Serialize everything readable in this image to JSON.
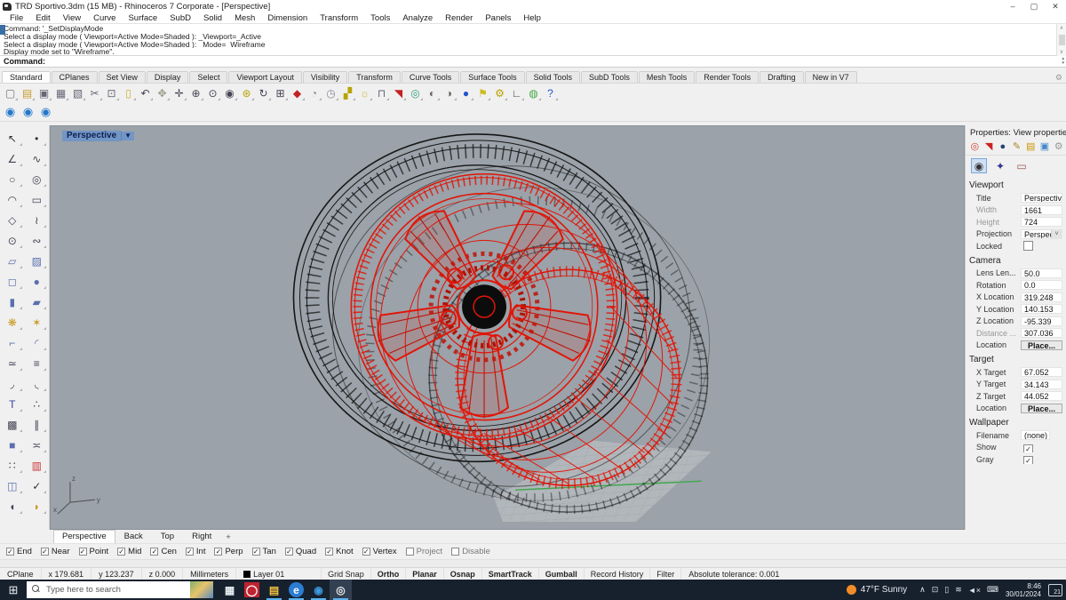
{
  "window": {
    "title": "TRD Sportivo.3dm (15 MB) - Rhinoceros 7 Corporate - [Perspective]",
    "controls": {
      "minimize": "–",
      "maximize": "▢",
      "close": "✕"
    }
  },
  "menu": {
    "items": [
      "File",
      "Edit",
      "View",
      "Curve",
      "Surface",
      "SubD",
      "Solid",
      "Mesh",
      "Dimension",
      "Transform",
      "Tools",
      "Analyze",
      "Render",
      "Panels",
      "Help"
    ]
  },
  "command": {
    "history": [
      "Command: '_SetDisplayMode",
      "Select a display mode ( Viewport=Active  Mode=Shaded ): _Viewport=_Active",
      "Select a display mode ( Viewport=Active  Mode=Shaded ): _Mode=_Wireframe",
      "Display mode set to \"Wireframe\"."
    ],
    "prompt": "Command:"
  },
  "tabbar": {
    "items": [
      {
        "label": "Standard",
        "active": true
      },
      {
        "label": "CPlanes"
      },
      {
        "label": "Set View"
      },
      {
        "label": "Display"
      },
      {
        "label": "Select"
      },
      {
        "label": "Viewport Layout"
      },
      {
        "label": "Visibility"
      },
      {
        "label": "Transform"
      },
      {
        "label": "Curve Tools"
      },
      {
        "label": "Surface Tools"
      },
      {
        "label": "Solid Tools"
      },
      {
        "label": "SubD Tools"
      },
      {
        "label": "Mesh Tools"
      },
      {
        "label": "Render Tools"
      },
      {
        "label": "Drafting"
      },
      {
        "label": "New in V7"
      }
    ],
    "gear": "⚙"
  },
  "toolbar1": {
    "icons": [
      {
        "name": "new-file-icon",
        "glyph": "▢",
        "color": "#777"
      },
      {
        "name": "open-file-icon",
        "glyph": "▤",
        "color": "#c99a2e"
      },
      {
        "name": "save-icon",
        "glyph": "▣",
        "color": "#667"
      },
      {
        "name": "print-icon",
        "glyph": "▦",
        "color": "#667"
      },
      {
        "name": "export-icon",
        "glyph": "▧",
        "color": "#667"
      },
      {
        "name": "cut-icon",
        "glyph": "✂",
        "color": "#667"
      },
      {
        "name": "copy-icon",
        "glyph": "⊡",
        "color": "#667"
      },
      {
        "name": "paste-icon",
        "glyph": "▯",
        "color": "#c9b22e"
      },
      {
        "name": "undo-icon",
        "glyph": "↶",
        "color": "#445"
      },
      {
        "name": "pan-icon",
        "glyph": "✥",
        "color": "#998"
      },
      {
        "name": "move-icon",
        "glyph": "✛",
        "color": "#445"
      },
      {
        "name": "zoom-dynamic-icon",
        "glyph": "⊕",
        "color": "#445"
      },
      {
        "name": "zoom-window-icon",
        "glyph": "⊙",
        "color": "#445"
      },
      {
        "name": "zoom-selected-icon",
        "glyph": "◉",
        "color": "#445"
      },
      {
        "name": "zoom-extents-icon",
        "glyph": "⊛",
        "color": "#b8a300"
      },
      {
        "name": "rotate-view-icon",
        "glyph": "↻",
        "color": "#445"
      },
      {
        "name": "viewport-layout-icon",
        "glyph": "⊞",
        "color": "#445"
      },
      {
        "name": "shaded-viewport-icon",
        "glyph": "◆",
        "color": "#c22222"
      },
      {
        "name": "set-view-icon",
        "glyph": "◔",
        "color": "#889"
      },
      {
        "name": "named-view-icon",
        "glyph": "◷",
        "color": "#889"
      },
      {
        "name": "cplane-icon",
        "glyph": "▞",
        "color": "#b8a300"
      },
      {
        "name": "lightbulb-icon",
        "glyph": "☼",
        "color": "#c9b22e"
      },
      {
        "name": "lock-icon",
        "glyph": "⊓",
        "color": "#667"
      },
      {
        "name": "display-mode-icon",
        "glyph": "◥",
        "color": "#c22222"
      },
      {
        "name": "color-wheel-icon",
        "glyph": "◎",
        "color": "#33a07a"
      },
      {
        "name": "shaded-sphere-icon",
        "glyph": "◐",
        "color": "#666"
      },
      {
        "name": "rendered-sphere-icon",
        "glyph": "◑",
        "color": "#666"
      },
      {
        "name": "raytraced-sphere-icon",
        "glyph": "●",
        "color": "#2255cc"
      },
      {
        "name": "flag-icon",
        "glyph": "⚑",
        "color": "#ccbb22"
      },
      {
        "name": "options-gear-icon",
        "glyph": "⚙",
        "color": "#b8a300"
      },
      {
        "name": "dimension-icon",
        "glyph": "∟",
        "color": "#445"
      },
      {
        "name": "earth-icon",
        "glyph": "◍",
        "color": "#44aa44"
      },
      {
        "name": "help-icon",
        "glyph": "?",
        "color": "#2255cc"
      }
    ]
  },
  "toolbar2": {
    "icons": [
      {
        "name": "blue-dial-icon-1",
        "glyph": "◉",
        "color": "#2277cc"
      },
      {
        "name": "blue-dial-icon-2",
        "glyph": "◉",
        "color": "#2277cc"
      },
      {
        "name": "blue-dial-icon-3",
        "glyph": "◉",
        "color": "#2277cc"
      }
    ]
  },
  "left_toolbar": {
    "icons": [
      {
        "name": "select-arrow-icon",
        "glyph": "↖",
        "color": "#333"
      },
      {
        "name": "point-icon",
        "glyph": "•",
        "color": "#333"
      },
      {
        "name": "polyline-icon",
        "glyph": "∠",
        "color": "#445"
      },
      {
        "name": "control-point-curve-icon",
        "glyph": "∿",
        "color": "#445"
      },
      {
        "name": "circle-icon",
        "glyph": "○",
        "color": "#445"
      },
      {
        "name": "ellipse-icon",
        "glyph": "◎",
        "color": "#445"
      },
      {
        "name": "arc-icon",
        "glyph": "◠",
        "color": "#445"
      },
      {
        "name": "rectangle-icon",
        "glyph": "▭",
        "color": "#445"
      },
      {
        "name": "polygon-icon",
        "glyph": "◇",
        "color": "#445"
      },
      {
        "name": "freeform-curve-icon",
        "glyph": "≀",
        "color": "#445"
      },
      {
        "name": "point-circle-icon",
        "glyph": "⊙",
        "color": "#445"
      },
      {
        "name": "helix-icon",
        "glyph": "∾",
        "color": "#445"
      },
      {
        "name": "surface-patch-icon",
        "glyph": "▱",
        "color": "#5b6fae"
      },
      {
        "name": "loft-icon",
        "glyph": "▨",
        "color": "#5b6fae"
      },
      {
        "name": "box-icon",
        "glyph": "◻",
        "color": "#5b6fae"
      },
      {
        "name": "sphere-icon",
        "glyph": "●",
        "color": "#5b6fae"
      },
      {
        "name": "cylinder-icon",
        "glyph": "▮",
        "color": "#5b6fae"
      },
      {
        "name": "plane-icon",
        "glyph": "▰",
        "color": "#5b6fae"
      },
      {
        "name": "boolean-icon",
        "glyph": "❋",
        "color": "#cc9922"
      },
      {
        "name": "explode-icon",
        "glyph": "✶",
        "color": "#cc9922"
      },
      {
        "name": "extrude-icon",
        "glyph": "⌐",
        "color": "#5b6fae"
      },
      {
        "name": "fillet-edge-icon",
        "glyph": "◜",
        "color": "#5b6fae"
      },
      {
        "name": "blend-icon",
        "glyph": "≃",
        "color": "#445"
      },
      {
        "name": "offset-icon",
        "glyph": "≡",
        "color": "#445"
      },
      {
        "name": "fillet-curve-icon",
        "glyph": "◞",
        "color": "#445"
      },
      {
        "name": "blend-curve-icon",
        "glyph": "◟",
        "color": "#445"
      },
      {
        "name": "text-icon",
        "glyph": "T",
        "color": "#334499"
      },
      {
        "name": "points-on-icon",
        "glyph": "∴",
        "color": "#445"
      },
      {
        "name": "block-icon",
        "glyph": "▩",
        "color": "#445"
      },
      {
        "name": "align-icon",
        "glyph": "∥",
        "color": "#445"
      },
      {
        "name": "solid-tools-icon",
        "glyph": "■",
        "color": "#5b6fae"
      },
      {
        "name": "dimension-tool-icon",
        "glyph": "≍",
        "color": "#445"
      },
      {
        "name": "array-icon",
        "glyph": "∷",
        "color": "#445"
      },
      {
        "name": "material-icon",
        "glyph": "▥",
        "color": "#cc3333"
      },
      {
        "name": "group-icon",
        "glyph": "◫",
        "color": "#5b6fae"
      },
      {
        "name": "check-icon",
        "glyph": "✓",
        "color": "#333"
      },
      {
        "name": "filter-tool-icon",
        "glyph": "◖",
        "color": "#445"
      },
      {
        "name": "lasso-icon",
        "glyph": "◗",
        "color": "#cc9922"
      }
    ]
  },
  "viewport": {
    "label": "Perspective",
    "dropdown_arrow": "▼"
  },
  "properties": {
    "header": "Properties: View properties",
    "tab_icons": [
      {
        "name": "properties-tab-icon",
        "glyph": "◎",
        "color": "#cc4433"
      },
      {
        "name": "display-tab-icon",
        "glyph": "◥",
        "color": "#cc2222"
      },
      {
        "name": "context-tab-icon",
        "glyph": "●",
        "color": "#224477"
      },
      {
        "name": "annotate-tab-icon",
        "glyph": "✎",
        "color": "#aa8822"
      },
      {
        "name": "files-tab-icon",
        "glyph": "▤",
        "color": "#cc9900"
      },
      {
        "name": "named-views-tab-icon",
        "glyph": "▣",
        "color": "#4488cc"
      },
      {
        "name": "panel-settings-icon",
        "glyph": "⚙",
        "color": "#999"
      }
    ],
    "sub_icons": [
      {
        "name": "view-properties-icon",
        "glyph": "◉",
        "color": "#333",
        "selected": true
      },
      {
        "name": "light-properties-icon",
        "glyph": "✦",
        "color": "#333399"
      },
      {
        "name": "wallpaper-properties-icon",
        "glyph": "▭",
        "color": "#995555"
      }
    ],
    "sections": {
      "viewport": {
        "title": "Viewport",
        "rows": [
          {
            "label": "Title",
            "value": "Perspective"
          },
          {
            "label": "Width",
            "value": "1661",
            "muted": true
          },
          {
            "label": "Height",
            "value": "724",
            "muted": true
          },
          {
            "label": "Projection",
            "value": "Perspecti...",
            "dropdown": true
          },
          {
            "label": "Locked",
            "value": "",
            "check": true,
            "checked": false
          }
        ]
      },
      "camera": {
        "title": "Camera",
        "rows": [
          {
            "label": "Lens Len...",
            "value": "50.0"
          },
          {
            "label": "Rotation",
            "value": "0.0"
          },
          {
            "label": "X Location",
            "value": "319.248"
          },
          {
            "label": "Y Location",
            "value": "140.153"
          },
          {
            "label": "Z Location",
            "value": "-95.339"
          },
          {
            "label": "Distance ...",
            "value": "307.036",
            "muted": true
          },
          {
            "label": "Location",
            "value": "Place...",
            "button": true
          }
        ]
      },
      "target": {
        "title": "Target",
        "rows": [
          {
            "label": "X Target",
            "value": "67.052"
          },
          {
            "label": "Y Target",
            "value": "34.143"
          },
          {
            "label": "Z Target",
            "value": "44.052"
          },
          {
            "label": "Location",
            "value": "Place...",
            "button": true
          }
        ]
      },
      "wallpaper": {
        "title": "Wallpaper",
        "rows": [
          {
            "label": "Filename",
            "value": "(none)",
            "file": true
          },
          {
            "label": "Show",
            "value": "",
            "check": true,
            "checked": true
          },
          {
            "label": "Gray",
            "value": "",
            "check": true,
            "checked": true
          }
        ]
      }
    }
  },
  "viewport_tabs": {
    "items": [
      {
        "label": "Perspective",
        "active": true
      },
      {
        "label": "Back"
      },
      {
        "label": "Top"
      },
      {
        "label": "Right"
      }
    ],
    "add_label": "+"
  },
  "osnap": {
    "items": [
      {
        "label": "End",
        "checked": true
      },
      {
        "label": "Near",
        "checked": true
      },
      {
        "label": "Point",
        "checked": true
      },
      {
        "label": "Mid",
        "checked": true
      },
      {
        "label": "Cen",
        "checked": true
      },
      {
        "label": "Int",
        "checked": true
      },
      {
        "label": "Perp",
        "checked": true
      },
      {
        "label": "Tan",
        "checked": true
      },
      {
        "label": "Quad",
        "checked": true
      },
      {
        "label": "Knot",
        "checked": true
      },
      {
        "label": "Vertex",
        "checked": true
      },
      {
        "label": "Project",
        "checked": false
      },
      {
        "label": "Disable",
        "checked": false
      }
    ]
  },
  "status": {
    "cplane": "CPlane",
    "x": "x 179.681",
    "y": "y 123.237",
    "z": "z 0.000",
    "units": "Millimeters",
    "layer": "Layer 01",
    "toggles": [
      {
        "label": "Grid Snap",
        "active": false
      },
      {
        "label": "Ortho",
        "active": true
      },
      {
        "label": "Planar",
        "active": true
      },
      {
        "label": "Osnap",
        "active": true
      },
      {
        "label": "SmartTrack",
        "active": true
      },
      {
        "label": "Gumball",
        "active": true
      },
      {
        "label": "Record History",
        "active": false
      },
      {
        "label": "Filter",
        "active": false
      }
    ],
    "tolerance": "Absolute tolerance: 0.001"
  },
  "taskbar": {
    "start_glyph": "⊞",
    "search_placeholder": "Type here to search",
    "apps": [
      {
        "name": "task-view-icon",
        "glyph": "▦",
        "color": "#e8edf2"
      },
      {
        "name": "opera-icon",
        "glyph": "◯",
        "color": "#ffffff",
        "bg": "#bf2330"
      },
      {
        "name": "file-explorer-icon",
        "glyph": "▤",
        "color": "#f0c040",
        "underline": true
      },
      {
        "name": "edge-icon",
        "glyph": "e",
        "color": "#ffffff",
        "bg": "#2b7cd3",
        "round": true,
        "underline": true
      },
      {
        "name": "blue-orb-app-icon",
        "glyph": "◉",
        "color": "#3b9ae1",
        "underline": true
      },
      {
        "name": "rhino-app-icon",
        "glyph": "◎",
        "color": "#e8e8e8",
        "active": true,
        "underline": true
      }
    ],
    "weather": "47°F Sunny",
    "tray": [
      {
        "name": "chevron-up-icon",
        "glyph": "∧"
      },
      {
        "name": "display-icon",
        "glyph": "⊡"
      },
      {
        "name": "phone-icon",
        "glyph": "▯"
      },
      {
        "name": "wifi-icon",
        "glyph": "≋"
      },
      {
        "name": "volume-muted-icon",
        "glyph": "◄×"
      },
      {
        "name": "keyboard-icon",
        "glyph": "⌨"
      }
    ],
    "clock": {
      "time": "8:46",
      "date": "30/01/2024"
    },
    "notification_count": "21"
  },
  "colors": {
    "accent_red": "#e11508",
    "tire_black": "#161616",
    "viewport_bg": "#9ba2a9",
    "grid_green": "#3da84a"
  }
}
